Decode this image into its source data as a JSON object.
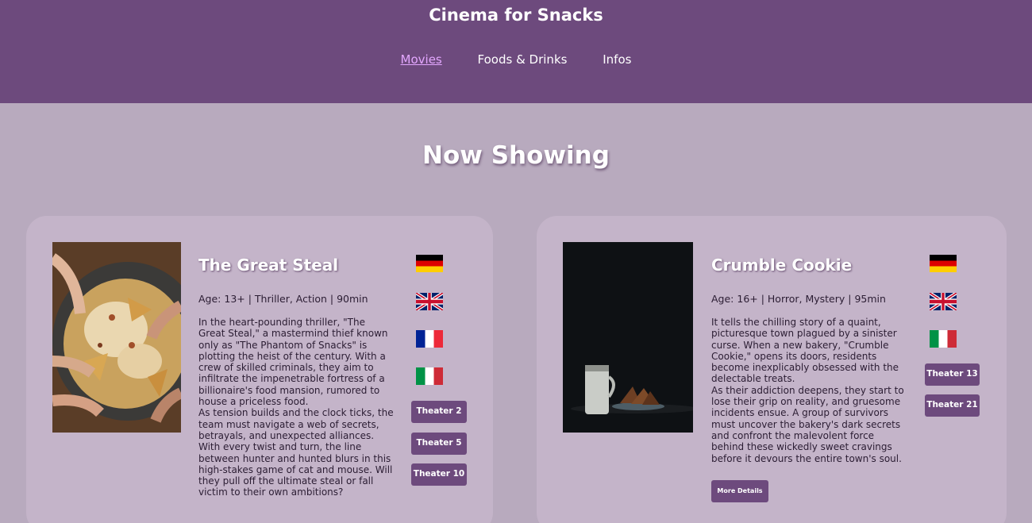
{
  "header": {
    "title": "Cinema for Snacks",
    "nav": [
      {
        "label": "Movies",
        "active": true
      },
      {
        "label": "Foods & Drinks",
        "active": false
      },
      {
        "label": "Infos",
        "active": false
      }
    ]
  },
  "section_title": "Now Showing",
  "movies": [
    {
      "title": "The Great Steal",
      "meta": "Age: 13+ | Thriller, Action | 90min",
      "description": [
        "In the heart-pounding thriller, \"The Great Steal,\" a mastermind thief known only as \"The Phantom of Snacks\" is plotting the heist of the century. With a crew of skilled criminals, they aim to infiltrate the impenetrable fortress of a billionaire's food mansion, rumored to house a priceless food.",
        "As tension builds and the clock ticks, the team must navigate a web of secrets, betrayals, and unexpected alliances. With every twist and turn, the line between hunter and hunted blurs in this high-stakes game of cat and mouse. Will they pull off the ultimate steal or fall victim to their own ambitions?"
      ],
      "languages": [
        "german-flag",
        "uk-flag",
        "france-flag",
        "italy-flag"
      ],
      "theaters": [
        "Theater 2",
        "Theater 5",
        "Theater 10"
      ]
    },
    {
      "title": "Crumble Cookie",
      "meta": "Age: 16+ | Horror, Mystery | 95min",
      "description": [
        "It tells the chilling story of a quaint, picturesque town plagued by a sinister curse. When a new bakery, \"Crumble Cookie,\" opens its doors, residents become inexplicably obsessed with the delectable treats.",
        "As their addiction deepens, they start to lose their grip on reality, and gruesome incidents ensue. A group of survivors must uncover the bakery's dark secrets and confront the malevolent force behind these wickedly sweet cravings before it devours the entire town's soul."
      ],
      "languages": [
        "german-flag",
        "uk-flag",
        "italy-flag"
      ],
      "theaters": [
        "Theater 13",
        "Theater 21"
      ],
      "more_label": "More Details"
    }
  ],
  "colors": {
    "header_bg": "#6d4a7d",
    "page_bg": "#b8aabe",
    "card_bg": "#c4b4c9",
    "nav_active": "#e3a7ff",
    "button_bg": "#6d4a7d"
  }
}
